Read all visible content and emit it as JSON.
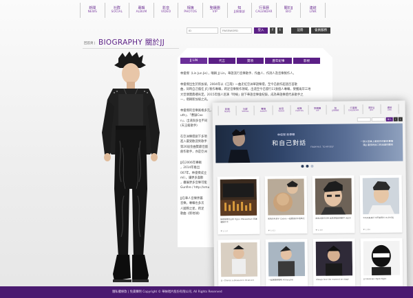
{
  "nav": [
    {
      "zh": "新聞",
      "en": "NEWS"
    },
    {
      "zh": "社群",
      "en": "SOCIAL"
    },
    {
      "zh": "專輯",
      "en": "ALBUM"
    },
    {
      "zh": "影音",
      "en": "VIDEO"
    },
    {
      "zh": "相簿",
      "en": "PHOTOS"
    },
    {
      "zh": "聖蹟團",
      "en": "VIP"
    },
    {
      "zh": "知",
      "en": "JJ俱樂部"
    },
    {
      "zh": "行事曆",
      "en": "CALENDAR"
    },
    {
      "zh": "關於JJ",
      "en": "BIO"
    },
    {
      "zh": "連結",
      "en": "LINK"
    }
  ],
  "login": {
    "id_placeholder": "ID",
    "password_placeholder": "PASSWORD",
    "login_label": "登入",
    "fb_label": "f",
    "twitter_label": "t",
    "register_label": "註冊",
    "member_label": "會員服務"
  },
  "page": {
    "crumb": "回首頁 |",
    "title": "BIOGRAPHY 關於JJ"
  },
  "tabs": [
    "JJ LIN",
    "代言",
    "獎項",
    "歷年紀事",
    "影視"
  ],
  "bio": {
    "p1": "林俊傑（Lin Jun Jie），暱稱 JJ Lin，華語流行音樂歌手、作曲人、作詞人及音樂製作人。",
    "p2a": "林俊傑出生於新加坡，2004年以《江南》一曲走紅亞洲華語樂壇，至今已創作超過百首歌",
    "p2b": "曲，同時自己擔任 JFJ 製作專輯，跨足音樂製作領域，出道至今已發行11張個人專輯，榮獲兩岸三地",
    "p2c": "大型頒獎典禮肯定。2015年個人巡演「時線」創下華語音樂會紀錄，成為華語樂壇代表歌手之",
    "p2d": "一，堪稱新加坡之光。",
    "p3a": "林俊傑的音樂風格多元，擅長以",
    "p3b": "uth」、「曹操Cao",
    "p3c": "n」、出道與多位不同",
    "p3d": "(天王級歌手)",
    "p4a": "在亞洲樂壇創下多項",
    "p4b": "進入最受歡迎男歌手",
    "p4c": "第26屆金曲獎最佳國",
    "p4d": "創作歌手，亦是亞洲",
    "p5a": "JJ在2006年專輯",
    "p5b": "，2014年推出",
    "p5c": "007年，林俊傑成立",
    "p5d": "ml），讓更多喜歡",
    "p5e": "，擴展更多音樂可能",
    "p5f": "Gunfire / http://smu",
    "p6a": "JJ在華人音樂界屬",
    "p6b": "音樂，專輯也多次",
    "p6c": "人國際之星，跨足",
    "p6d": "歌曲《新地球》"
  },
  "overlay": {
    "nav": [
      {
        "zh": "新聞",
        "en": "NEWS"
      },
      {
        "zh": "社群",
        "en": "SOCIAL"
      },
      {
        "zh": "專輯",
        "en": "ALBUM"
      },
      {
        "zh": "影音",
        "en": "VIDEO"
      },
      {
        "zh": "相簿",
        "en": "PHOTOS"
      },
      {
        "zh": "聖蹟團",
        "en": "VIP"
      },
      {
        "zh": "知",
        "en": "JJ俱樂部"
      },
      {
        "zh": "行事曆",
        "en": "CALENDAR"
      },
      {
        "zh": "關於JJ",
        "en": "BIO"
      },
      {
        "zh": "連結",
        "en": "LINK"
      }
    ],
    "search_label": "登入",
    "banner": {
      "sub": "林俊傑 新專輯",
      "title": "和自己對話",
      "en": "FROM M.E. TO MYSELF",
      "side1": "一張以音樂上最寫作的數的專輯",
      "side2": "讓JJ 最想說出口的話讓你聽見"
    },
    "cards": [
      {
        "cap": "錄音室裡的日常 #JJLin #NewAlbum 新專輯製作中",
        "meta": "♥ 2,114"
      },
      {
        "cap": "和我的毛孩子 Cookie 一起度過的午後時光",
        "meta": "♥ 3,012"
      },
      {
        "cap": "謝謝大家的支持 巡迴演唱會倒數中 #JJ20",
        "meta": "♥ 2,487"
      },
      {
        "cap": "今天天氣真好 出門拍照去 #LifeOfJJ",
        "meta": "♥ 1,956"
      },
      {
        "cap": "JJ - Chance a pleasure in #concert",
        "meta": ""
      },
      {
        "cap": "一起來聽新歌吧 #Shanghai",
        "meta": ""
      },
      {
        "cap": "Always love the moment on stage",
        "meta": ""
      },
      {
        "cap": "JJ Celebrate #JJ20 Night",
        "meta": ""
      }
    ]
  },
  "footer": {
    "text": "隱私權條款 | 免責聲明   Copyright © 華納唱片股份有限公司, All Rights Reserved"
  },
  "colors": {
    "accent": "#5b1f86",
    "footer": "#4a1a70"
  }
}
